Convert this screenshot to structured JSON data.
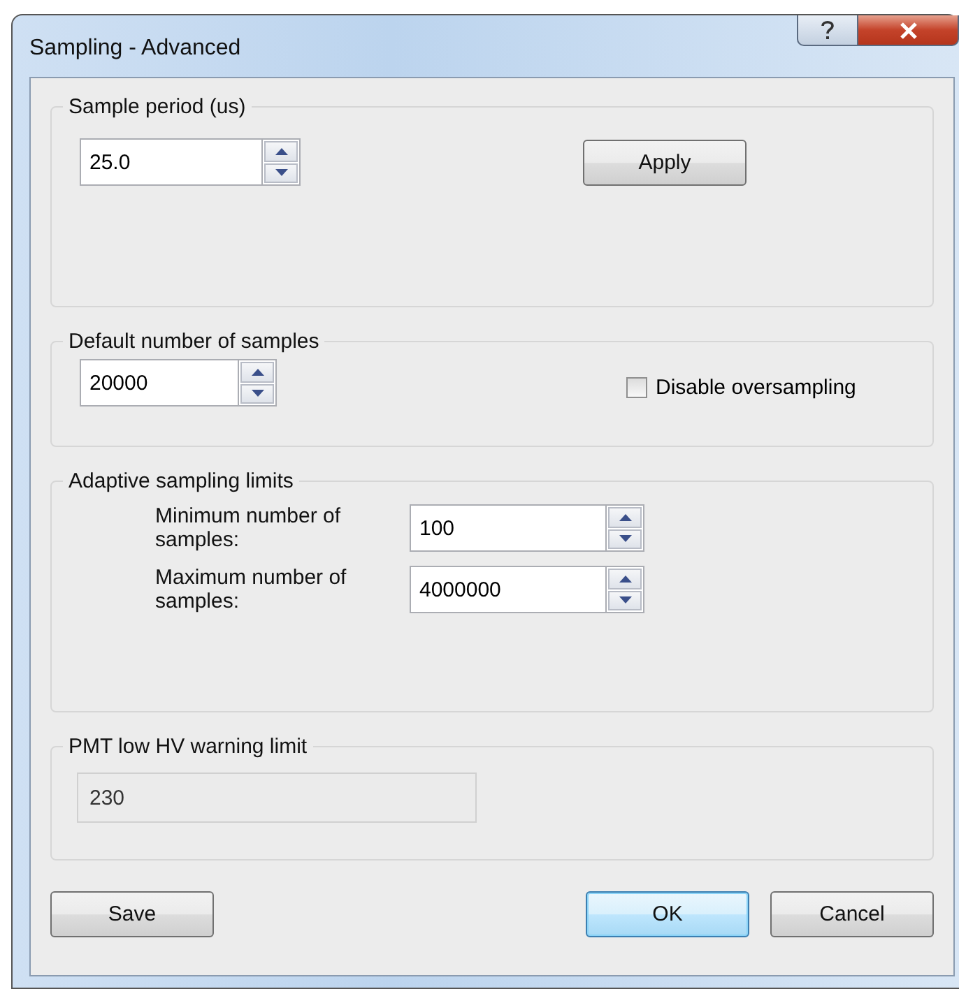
{
  "window": {
    "title": "Sampling - Advanced"
  },
  "sample_period": {
    "legend": "Sample period (us)",
    "value": "25.0",
    "button": "Apply"
  },
  "default_samples": {
    "legend": "Default number of samples",
    "value": "20000",
    "checkbox": {
      "label": "Disable oversampling",
      "checked": false
    }
  },
  "adaptive": {
    "legend": "Adaptive sampling limits",
    "fields": [
      {
        "label": "Minimum number of samples:",
        "value": "100"
      },
      {
        "label": "Maximum number of samples:",
        "value": "4000000"
      }
    ]
  },
  "pmt": {
    "legend": "PMT low HV warning limit",
    "value": "230",
    "disabled": true
  },
  "buttons": [
    {
      "label": "Save",
      "default": false
    },
    {
      "label": "OK",
      "default": true
    },
    {
      "label": "Cancel",
      "default": false
    }
  ]
}
